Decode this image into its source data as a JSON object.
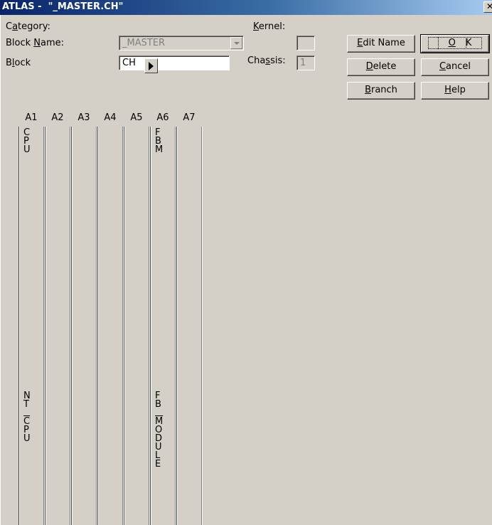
{
  "window": {
    "title": "ATLAS -  \"_MASTER.CH\"",
    "close_glyph": "✕"
  },
  "form": {
    "category_label": "Category:",
    "category_value": "_MASTER",
    "block_name_label": "Block Name:",
    "block_name_value": "CH",
    "block_label": "Block",
    "kernel_label": "Kernel:",
    "kernel_value": "",
    "chassis_label": "Chassis:",
    "chassis_value": "1"
  },
  "buttons": {
    "edit_name": "Edit Name",
    "ok": "OK",
    "delete": "Delete",
    "cancel": "Cancel",
    "branch": "Branch",
    "help": "Help"
  },
  "slots": [
    {
      "header": "A1",
      "top_text": [
        "C",
        "P",
        "U"
      ],
      "bottom_text": [
        "N",
        "T",
        "",
        "C",
        "P",
        "U"
      ],
      "overline_index": 3
    },
    {
      "header": "A2",
      "top_text": [],
      "bottom_text": []
    },
    {
      "header": "A3",
      "top_text": [],
      "bottom_text": []
    },
    {
      "header": "A4",
      "top_text": [],
      "bottom_text": []
    },
    {
      "header": "A5",
      "top_text": [],
      "bottom_text": []
    },
    {
      "header": "A6",
      "top_text": [
        "F",
        "B",
        "M"
      ],
      "bottom_text": [
        "F",
        "B",
        "",
        "M",
        "O",
        "D",
        "U",
        "L",
        "E"
      ],
      "overline_index": 3
    },
    {
      "header": "A7",
      "top_text": [],
      "bottom_text": []
    }
  ]
}
